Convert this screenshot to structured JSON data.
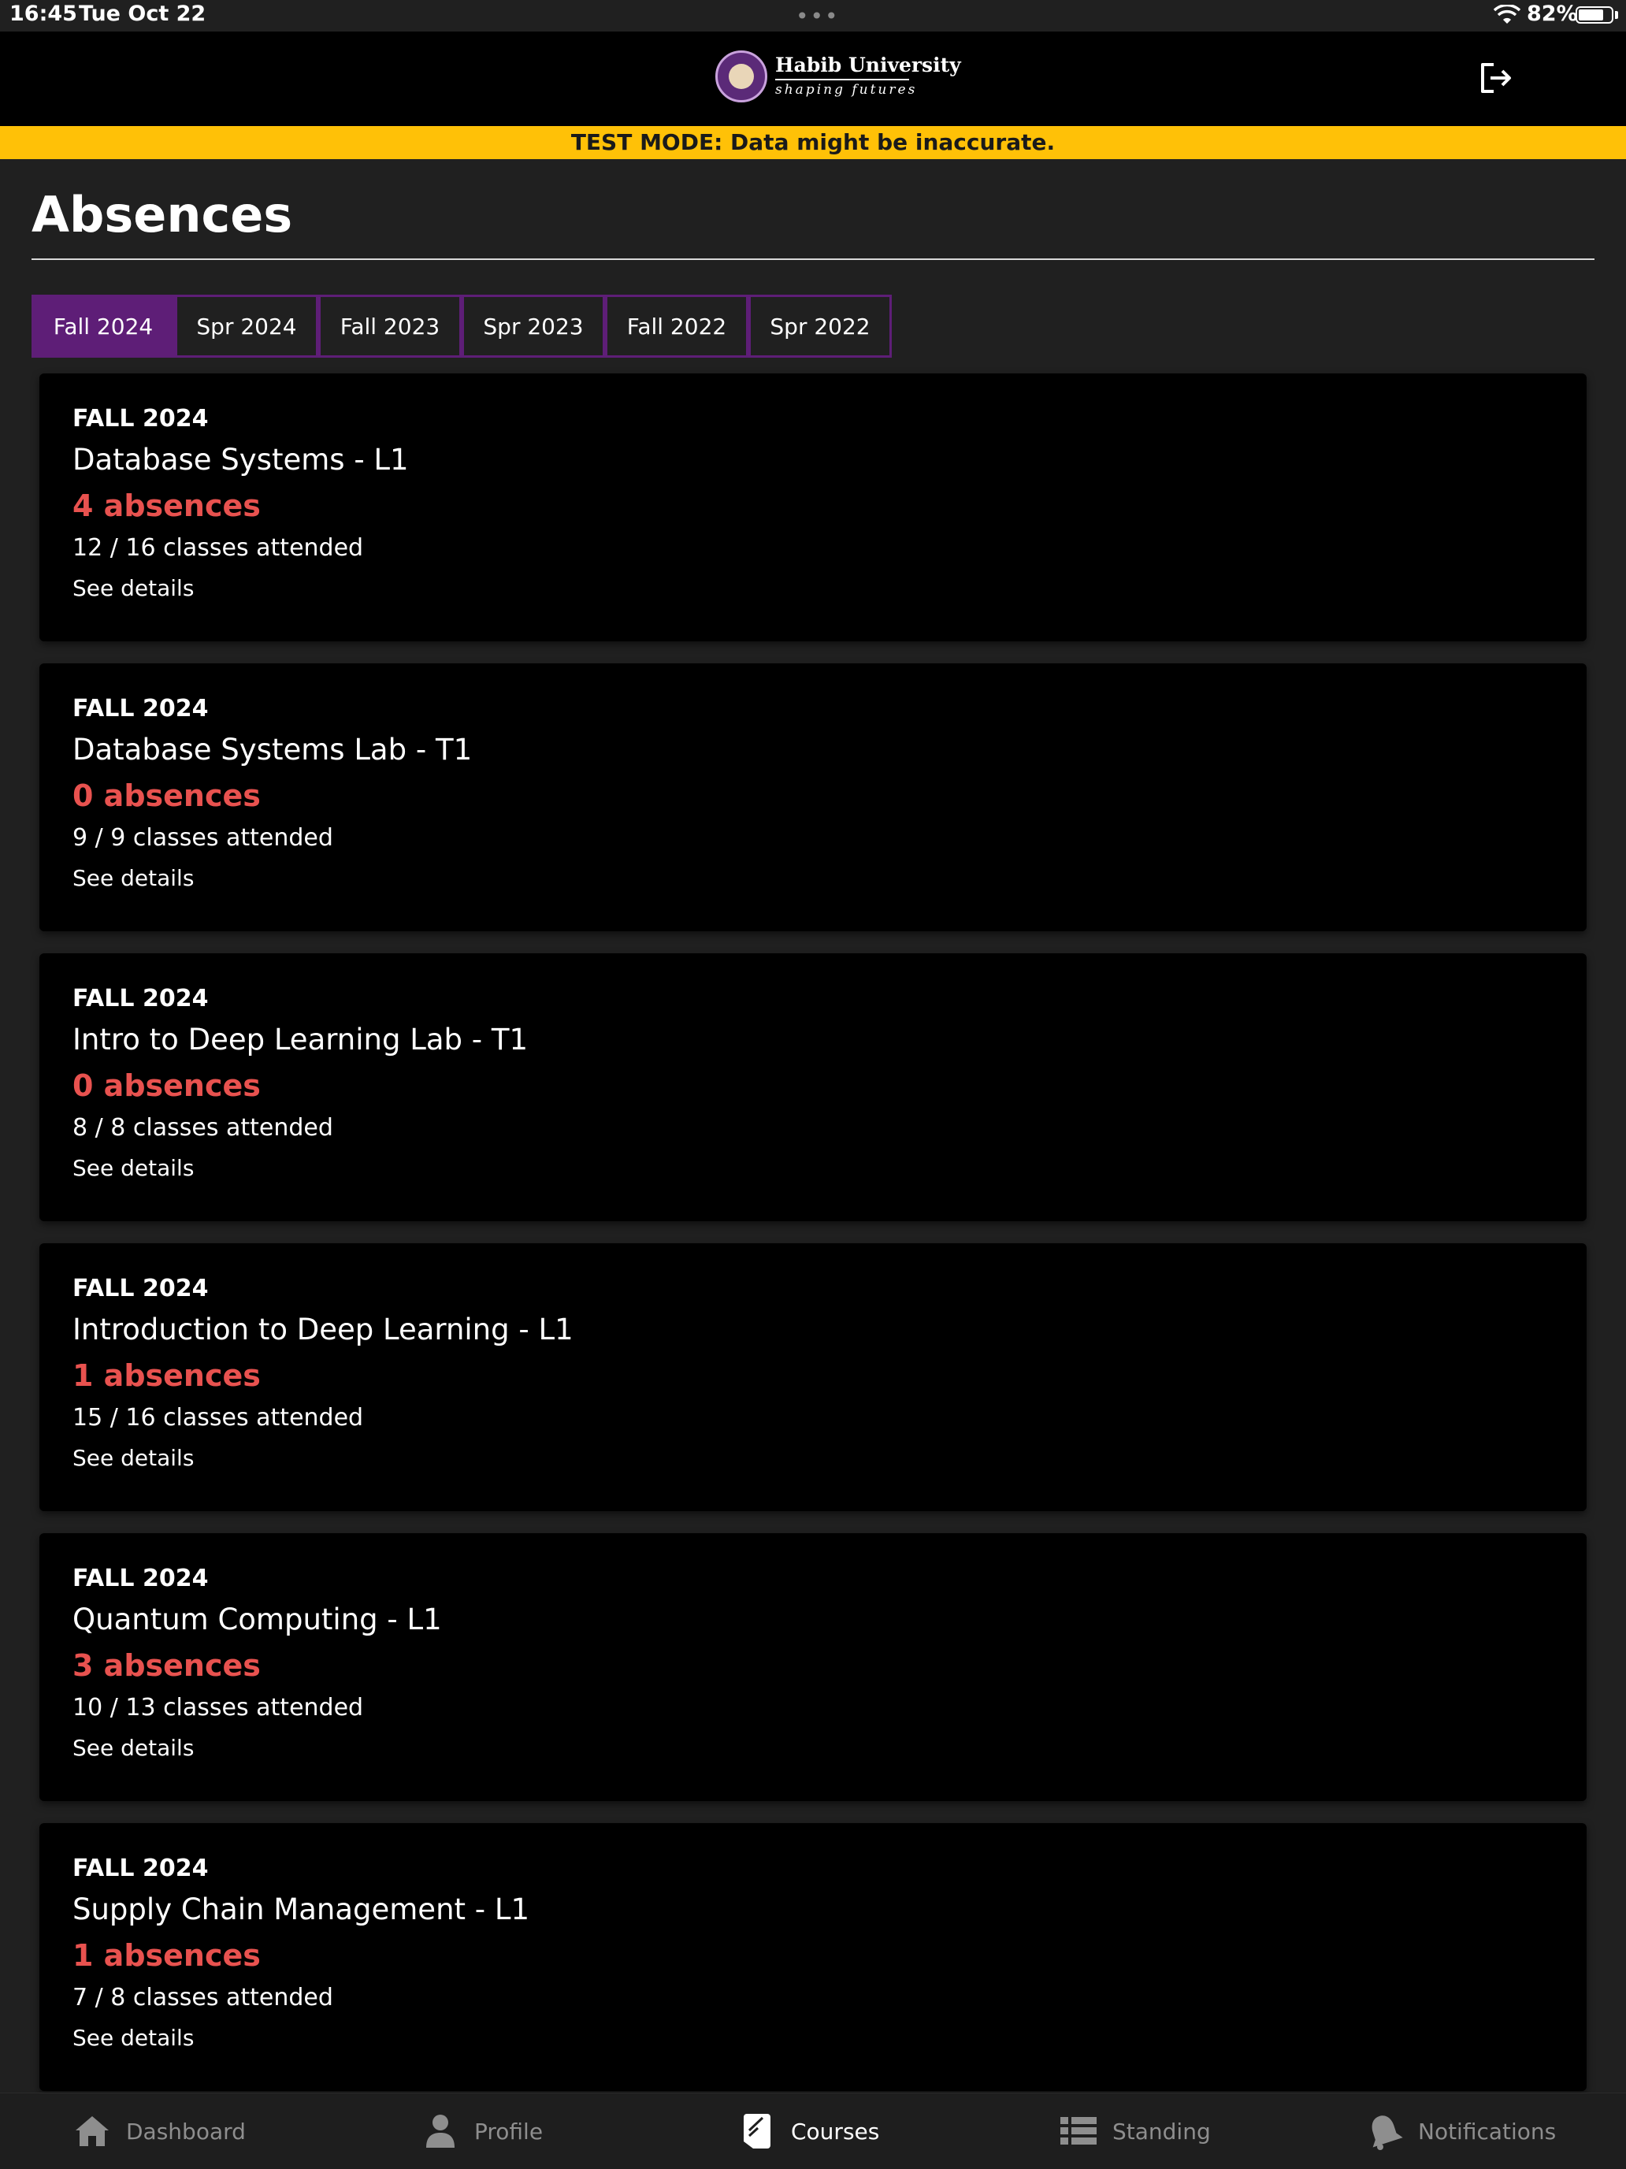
{
  "status_bar": {
    "time": "16:45",
    "date": "Tue Oct 22",
    "battery": "82%",
    "battery_level": 0.82
  },
  "header": {
    "logo_name": "Habib University",
    "logo_tagline": "shaping futures",
    "logout_icon": "logout-icon"
  },
  "banner": {
    "text": "TEST MODE: Data might be inaccurate."
  },
  "page": {
    "title": "Absences"
  },
  "tabs": [
    {
      "label": "Fall 2024",
      "active": true
    },
    {
      "label": "Spr 2024",
      "active": false
    },
    {
      "label": "Fall 2023",
      "active": false
    },
    {
      "label": "Spr 2023",
      "active": false
    },
    {
      "label": "Fall 2022",
      "active": false
    },
    {
      "label": "Spr 2022",
      "active": false
    }
  ],
  "cards": [
    {
      "term": "FALL 2024",
      "course": "Database Systems - L1",
      "absences": "4 absences",
      "attended": "12 / 16 classes attended",
      "link": "See details"
    },
    {
      "term": "FALL 2024",
      "course": "Database Systems Lab - T1",
      "absences": "0 absences",
      "attended": "9 / 9 classes attended",
      "link": "See details"
    },
    {
      "term": "FALL 2024",
      "course": "Intro to Deep Learning Lab - T1",
      "absences": "0 absences",
      "attended": "8 / 8 classes attended",
      "link": "See details"
    },
    {
      "term": "FALL 2024",
      "course": "Introduction to Deep Learning - L1",
      "absences": "1 absences",
      "attended": "15 / 16 classes attended",
      "link": "See details"
    },
    {
      "term": "FALL 2024",
      "course": "Quantum Computing - L1",
      "absences": "3 absences",
      "attended": "10 / 13 classes attended",
      "link": "See details"
    },
    {
      "term": "FALL 2024",
      "course": "Supply Chain Management - L1",
      "absences": "1 absences",
      "attended": "7 / 8 classes attended",
      "link": "See details"
    }
  ],
  "bottom_nav": [
    {
      "label": "Dashboard",
      "icon": "home-icon",
      "active": false
    },
    {
      "label": "Profile",
      "icon": "person-icon",
      "active": false
    },
    {
      "label": "Courses",
      "icon": "book-icon",
      "active": true
    },
    {
      "label": "Standing",
      "icon": "list-icon",
      "active": false
    },
    {
      "label": "Notifications",
      "icon": "bell-icon",
      "active": false
    }
  ],
  "colors": {
    "accent": "#5e1e77",
    "absence": "#e8524f",
    "banner": "#ffc107"
  }
}
